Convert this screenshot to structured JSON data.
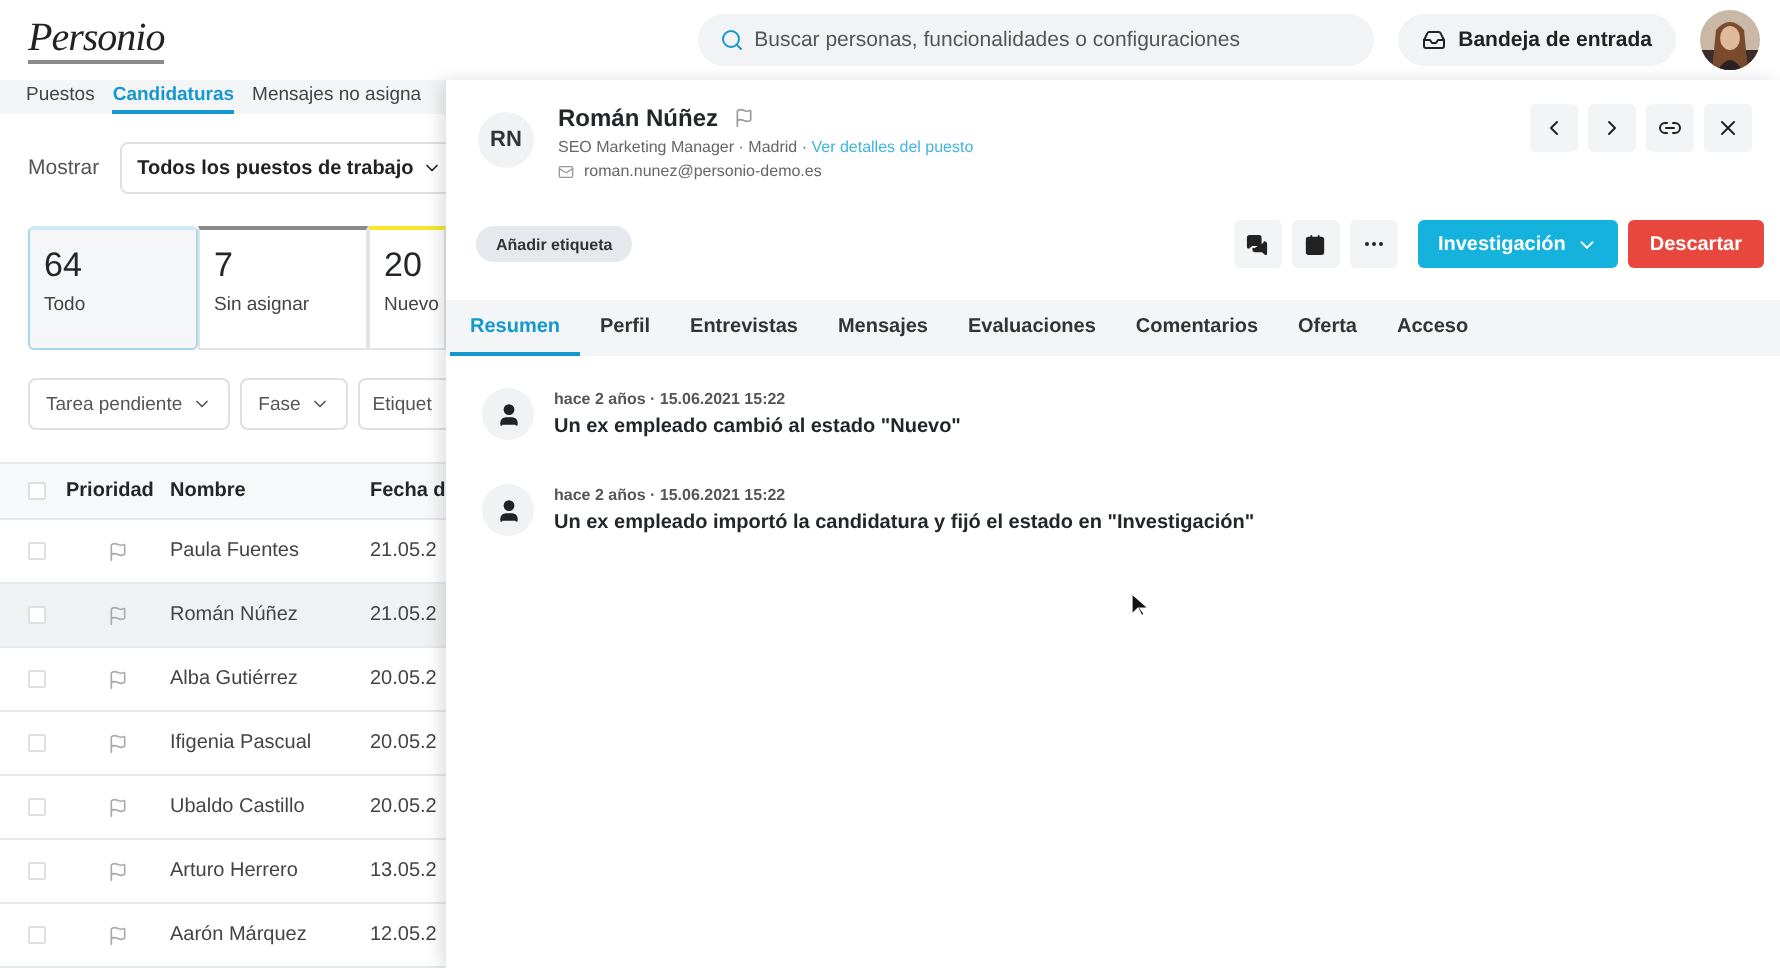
{
  "header": {
    "logo": "Personio",
    "search": {
      "placeholder": "Buscar personas, funcionalidades o configuraciones"
    },
    "inbox_button": "Bandeja de entrada"
  },
  "left_page": {
    "tabs": [
      {
        "label": "Puestos",
        "selected": false
      },
      {
        "label": "Candidaturas",
        "selected": true
      },
      {
        "label": "Mensajes no asigna",
        "selected": false
      }
    ],
    "show_label": "Mostrar",
    "show_dropdown": "Todos los puestos de trabajo",
    "stage_cards": [
      {
        "count": "64",
        "label": "Todo",
        "selected": true,
        "color": "#cfe8f5"
      },
      {
        "count": "7",
        "label": "Sin asignar",
        "selected": false,
        "color": "#8a8a8a"
      },
      {
        "count": "20",
        "label": "Nuevo",
        "selected": false,
        "color": "#f5e92a"
      }
    ],
    "filters": [
      {
        "label": "Tarea pendiente",
        "caret": true
      },
      {
        "label": "Fase",
        "caret": true
      },
      {
        "label": "Etiquet",
        "caret": false
      }
    ],
    "table": {
      "all_checked": false,
      "columns": [
        "Prioridad",
        "Nombre",
        "Fecha d"
      ],
      "rows": [
        {
          "checked": false,
          "name": "Paula Fuentes",
          "date": "21.05.2",
          "selected": false
        },
        {
          "checked": false,
          "name": "Román Núñez",
          "date": "21.05.2",
          "selected": true
        },
        {
          "checked": false,
          "name": "Alba Gutiérrez",
          "date": "20.05.2",
          "selected": false
        },
        {
          "checked": false,
          "name": "Ifigenia Pascual",
          "date": "20.05.2",
          "selected": false
        },
        {
          "checked": false,
          "name": "Ubaldo Castillo",
          "date": "20.05.2",
          "selected": false
        },
        {
          "checked": false,
          "name": "Arturo Herrero",
          "date": "13.05.2",
          "selected": false
        },
        {
          "checked": false,
          "name": "Aarón Márquez",
          "date": "12.05.2",
          "selected": false
        }
      ]
    }
  },
  "candidate_panel": {
    "initials": "RN",
    "name": "Román Núñez",
    "subtitle": "SEO Marketing Manager · Madrid · ",
    "job_link": "Ver detalles del puesto",
    "email": "roman.nunez@personio-demo.es",
    "tag_button": "Añadir etiqueta",
    "status_button": "Investigación",
    "discard_button": "Descartar",
    "tabs": [
      {
        "label": "Resumen",
        "selected": true
      },
      {
        "label": "Perfil",
        "selected": false
      },
      {
        "label": "Entrevistas",
        "selected": false
      },
      {
        "label": "Mensajes",
        "selected": false
      },
      {
        "label": "Evaluaciones",
        "selected": false
      },
      {
        "label": "Comentarios",
        "selected": false
      },
      {
        "label": "Oferta",
        "selected": false
      },
      {
        "label": "Acceso",
        "selected": false
      }
    ],
    "activity": [
      {
        "time": "hace 2 años · 15.06.2021 15:22",
        "text": "Un ex empleado cambió al estado \"Nuevo\""
      },
      {
        "time": "hace 2 años · 15.06.2021 15:22",
        "text": "Un ex empleado importó la candidatura y fijó el estado en \"Investigación\""
      }
    ]
  }
}
